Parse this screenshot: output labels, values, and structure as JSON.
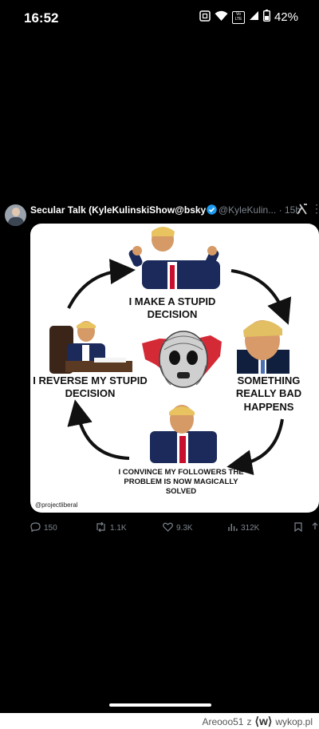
{
  "status_bar": {
    "time": "16:52",
    "battery": "42%",
    "network_badge": "Vo LTE"
  },
  "tweet": {
    "author": "Secular Talk (KyleKulinskiShow@bsky.so...",
    "handle": "@KyleKulin...",
    "separator": "·",
    "age": "15h"
  },
  "meme": {
    "top_caption": "I MAKE A STUPID DECISION",
    "right_caption": "SOMETHING REALLY BAD HAPPENS",
    "bottom_caption": "I CONVINCE MY FOLLOWERS THE PROBLEM IS NOW MAGICALLY SOLVED",
    "left_caption": "I REVERSE MY STUPID DECISION",
    "credit": "@projectliberal"
  },
  "actions": {
    "replies": "150",
    "reposts": "1.1K",
    "likes": "9.3K",
    "views": "312K"
  },
  "watermark": {
    "user": "Areooo51",
    "joiner": "z",
    "site": "wykop.pl"
  },
  "colors": {
    "background": "#000000",
    "muted": "#7d858d",
    "verified": "#1d9bf0",
    "map_red": "#d42a36"
  }
}
